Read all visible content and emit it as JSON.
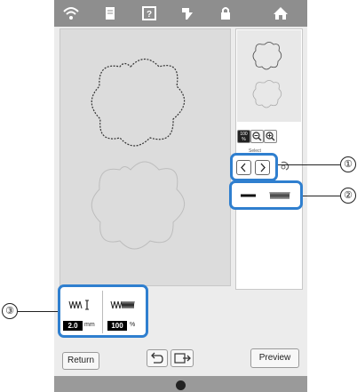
{
  "status_icons": [
    "wifi-icon",
    "document-icon",
    "help-icon",
    "thread-icon",
    "lock-icon",
    "home-icon"
  ],
  "zoom": {
    "label": "100\n%"
  },
  "select": {
    "tab_label": "Select"
  },
  "stitch_panel": {
    "width_value": "2.0",
    "width_unit": "mm",
    "density_value": "100",
    "density_unit": "%"
  },
  "buttons": {
    "return_label": "Return",
    "preview_label": "Preview"
  },
  "callouts": {
    "one": "①",
    "two": "②",
    "three": "③"
  },
  "colors": {
    "highlight": "#2f7fcf",
    "statusbar": "#8e8e8e",
    "screen": "#ececec"
  }
}
